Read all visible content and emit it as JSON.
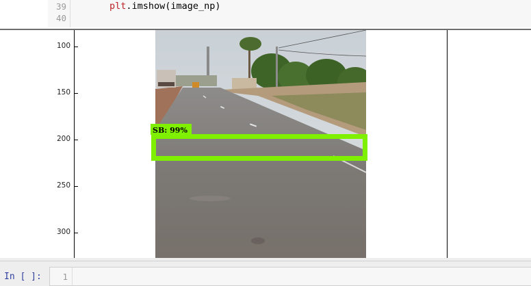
{
  "code_cell": {
    "lines": [
      {
        "num": "39",
        "code_module": "plt",
        "code_rest": ".imshow(image_np)"
      },
      {
        "num": "40",
        "code_module": "",
        "code_rest": ""
      }
    ]
  },
  "output": {
    "y_ticks": [
      "100",
      "150",
      "200",
      "250",
      "300"
    ],
    "detection": {
      "label": "SB: 99%",
      "color": "#7ff000"
    },
    "image_icon": "road-photo"
  },
  "next_cell": {
    "prompt": "In [ ]:",
    "line_num": "1"
  }
}
